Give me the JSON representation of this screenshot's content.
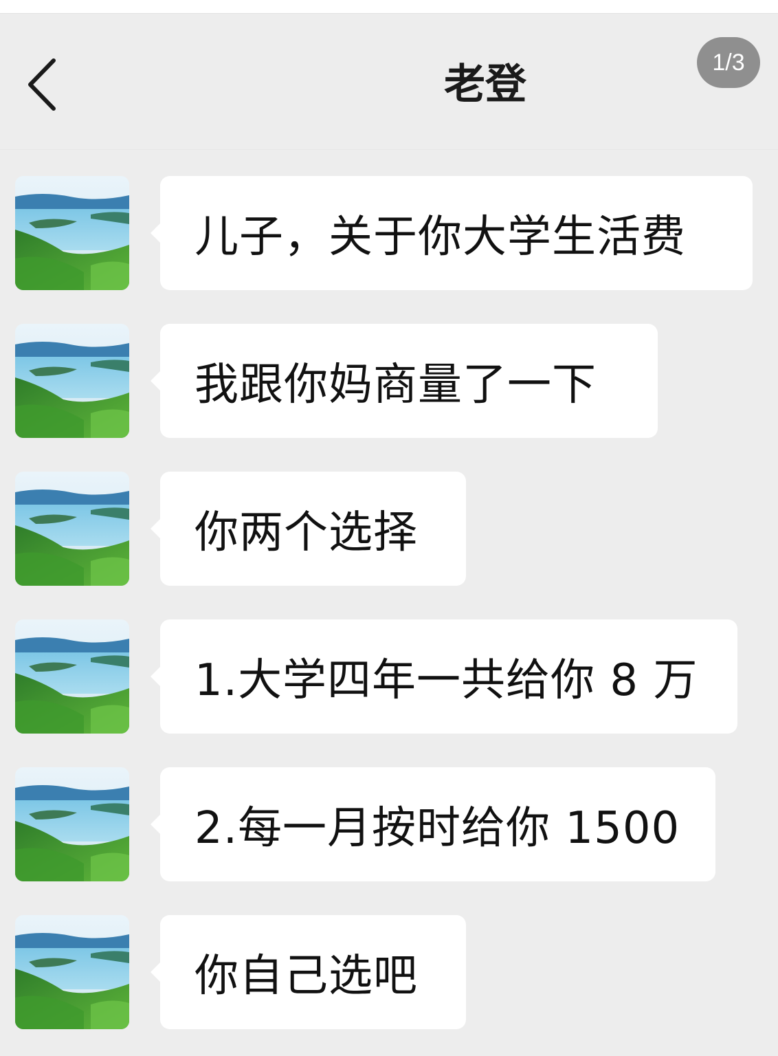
{
  "header": {
    "title": "老登",
    "page_indicator": "1/3",
    "back_icon": "chevron-left-icon"
  },
  "messages": [
    {
      "text": "儿子，关于你大学生活费",
      "avatar_icon": "landscape-avatar-icon"
    },
    {
      "text": "我跟你妈商量了一下",
      "avatar_icon": "landscape-avatar-icon"
    },
    {
      "text": "你两个选择",
      "avatar_icon": "landscape-avatar-icon"
    },
    {
      "text": "1.大学四年一共给你 8 万",
      "avatar_icon": "landscape-avatar-icon"
    },
    {
      "text": "2.每一月按时给你 1500",
      "avatar_icon": "landscape-avatar-icon"
    },
    {
      "text": "你自己选吧",
      "avatar_icon": "landscape-avatar-icon"
    }
  ],
  "colors": {
    "background": "#ededed",
    "bubble": "#ffffff",
    "indicator": "#8f8f8f"
  }
}
